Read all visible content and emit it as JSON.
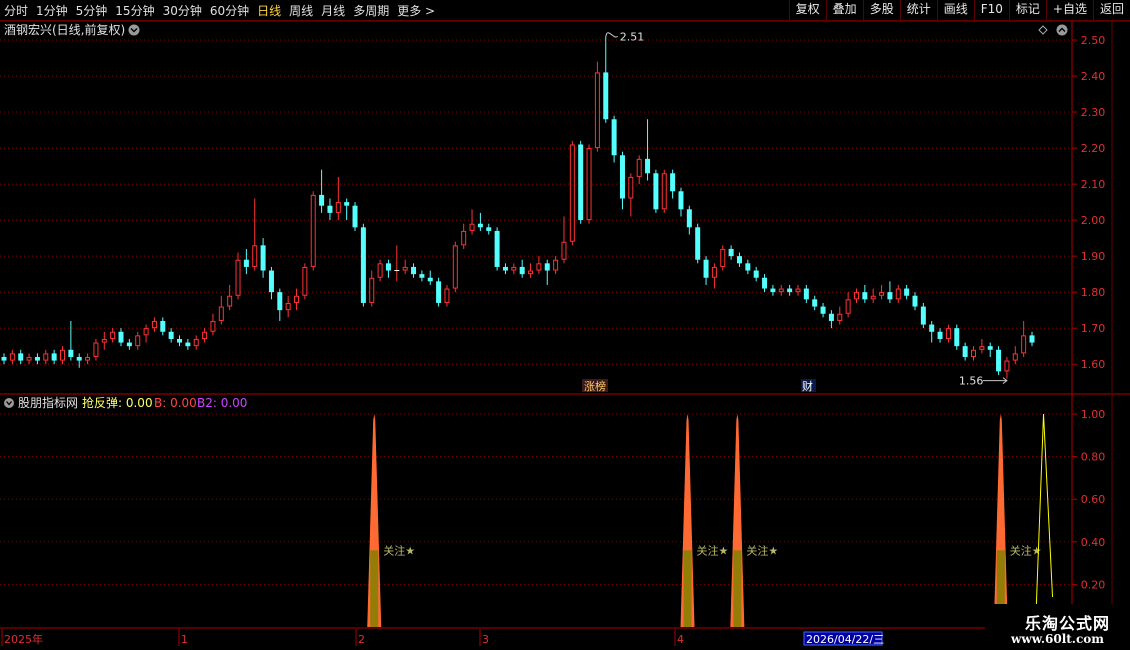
{
  "toolbar": {
    "periods": [
      "分时",
      "1分钟",
      "5分钟",
      "15分钟",
      "30分钟",
      "60分钟",
      "日线",
      "周线",
      "月线",
      "多周期",
      "更多 >"
    ],
    "active_period": "日线",
    "buttons": [
      "复权",
      "叠加",
      "多股",
      "统计",
      "画线",
      "F10",
      "标记",
      "+自选",
      "返回"
    ]
  },
  "main": {
    "title": "酒钢宏兴(日线,前复权)",
    "high_label": "2.51",
    "low_label": "1.56",
    "tag_zhangbang": "涨榜",
    "tag_cai": "财"
  },
  "indicator": {
    "title": "股朋指标网",
    "line1_label": "抢反弹: 0.00",
    "line2_label": "B: 0.00",
    "line3_label": "B2: 0.00",
    "signal_text": "关注★"
  },
  "date_axis": {
    "labels": [
      "2025年",
      "1",
      "2",
      "3",
      "4"
    ],
    "cursor_date": "2026/04/22/三"
  },
  "watermark": {
    "name": "乐淘公式网",
    "url": "www.60lt.com"
  },
  "colors": {
    "up": "#ff3232",
    "down": "#54ffff",
    "signal": "#ff6a33",
    "signal_mid": "#808000",
    "b2": "#ffff00",
    "grid": "#8b0000"
  },
  "chart_data": {
    "type": "candlestick",
    "price_axis": {
      "ylim": [
        1.52,
        2.55
      ],
      "ticks": [
        "2.50",
        "2.40",
        "2.30",
        "2.20",
        "2.10",
        "2.00",
        "1.90",
        "1.80",
        "1.70",
        "1.60"
      ]
    },
    "indicator_axis": {
      "ylim": [
        0,
        1.0
      ],
      "ticks": [
        "1.00",
        "0.80",
        "0.60",
        "0.40",
        "0.20"
      ]
    },
    "candles": [
      [
        1.62,
        1.61,
        1.63,
        1.6
      ],
      [
        1.61,
        1.63,
        1.64,
        1.6
      ],
      [
        1.63,
        1.61,
        1.64,
        1.6
      ],
      [
        1.61,
        1.62,
        1.63,
        1.6
      ],
      [
        1.62,
        1.61,
        1.63,
        1.6
      ],
      [
        1.61,
        1.63,
        1.64,
        1.6
      ],
      [
        1.63,
        1.61,
        1.64,
        1.6
      ],
      [
        1.61,
        1.64,
        1.65,
        1.6
      ],
      [
        1.64,
        1.62,
        1.72,
        1.61
      ],
      [
        1.62,
        1.61,
        1.63,
        1.59
      ],
      [
        1.61,
        1.62,
        1.63,
        1.6
      ],
      [
        1.62,
        1.66,
        1.67,
        1.61
      ],
      [
        1.66,
        1.67,
        1.69,
        1.64
      ],
      [
        1.67,
        1.69,
        1.7,
        1.66
      ],
      [
        1.69,
        1.66,
        1.7,
        1.65
      ],
      [
        1.66,
        1.65,
        1.67,
        1.64
      ],
      [
        1.65,
        1.68,
        1.69,
        1.64
      ],
      [
        1.68,
        1.7,
        1.71,
        1.66
      ],
      [
        1.7,
        1.72,
        1.73,
        1.69
      ],
      [
        1.72,
        1.69,
        1.73,
        1.68
      ],
      [
        1.69,
        1.67,
        1.7,
        1.66
      ],
      [
        1.67,
        1.66,
        1.68,
        1.65
      ],
      [
        1.66,
        1.65,
        1.67,
        1.64
      ],
      [
        1.65,
        1.67,
        1.68,
        1.64
      ],
      [
        1.67,
        1.69,
        1.7,
        1.66
      ],
      [
        1.69,
        1.72,
        1.74,
        1.68
      ],
      [
        1.72,
        1.76,
        1.79,
        1.71
      ],
      [
        1.76,
        1.79,
        1.82,
        1.75
      ],
      [
        1.79,
        1.89,
        1.91,
        1.78
      ],
      [
        1.89,
        1.87,
        1.92,
        1.85
      ],
      [
        1.87,
        1.93,
        2.06,
        1.86
      ],
      [
        1.93,
        1.86,
        1.95,
        1.84
      ],
      [
        1.86,
        1.8,
        1.87,
        1.78
      ],
      [
        1.8,
        1.75,
        1.81,
        1.72
      ],
      [
        1.75,
        1.77,
        1.79,
        1.73
      ],
      [
        1.77,
        1.79,
        1.81,
        1.75
      ],
      [
        1.79,
        1.87,
        1.88,
        1.78
      ],
      [
        1.87,
        2.07,
        2.08,
        1.86
      ],
      [
        2.07,
        2.04,
        2.14,
        2.02
      ],
      [
        2.04,
        2.02,
        2.06,
        2.0
      ],
      [
        2.02,
        2.05,
        2.12,
        2.0
      ],
      [
        2.05,
        2.04,
        2.06,
        2.0
      ],
      [
        2.04,
        1.98,
        2.05,
        1.97
      ],
      [
        1.98,
        1.77,
        1.99,
        1.76
      ],
      [
        1.77,
        1.84,
        1.86,
        1.76
      ],
      [
        1.84,
        1.88,
        1.89,
        1.83
      ],
      [
        1.88,
        1.86,
        1.89,
        1.84
      ],
      [
        1.86,
        1.86,
        1.93,
        1.83
      ],
      [
        1.86,
        1.87,
        1.89,
        1.85
      ],
      [
        1.87,
        1.85,
        1.88,
        1.84
      ],
      [
        1.85,
        1.84,
        1.86,
        1.83
      ],
      [
        1.84,
        1.83,
        1.86,
        1.82
      ],
      [
        1.83,
        1.77,
        1.84,
        1.76
      ],
      [
        1.77,
        1.81,
        1.82,
        1.76
      ],
      [
        1.81,
        1.93,
        1.94,
        1.8
      ],
      [
        1.93,
        1.97,
        1.99,
        1.92
      ],
      [
        1.97,
        1.99,
        2.03,
        1.96
      ],
      [
        1.99,
        1.98,
        2.02,
        1.97
      ],
      [
        1.98,
        1.97,
        1.99,
        1.96
      ],
      [
        1.97,
        1.87,
        1.98,
        1.86
      ],
      [
        1.87,
        1.86,
        1.88,
        1.85
      ],
      [
        1.86,
        1.87,
        1.88,
        1.85
      ],
      [
        1.87,
        1.85,
        1.89,
        1.84
      ],
      [
        1.85,
        1.86,
        1.88,
        1.84
      ],
      [
        1.86,
        1.88,
        1.9,
        1.85
      ],
      [
        1.88,
        1.86,
        1.89,
        1.82
      ],
      [
        1.86,
        1.89,
        1.9,
        1.85
      ],
      [
        1.89,
        1.94,
        2.01,
        1.88
      ],
      [
        1.94,
        2.21,
        2.22,
        1.93
      ],
      [
        2.21,
        2.0,
        2.22,
        1.99
      ],
      [
        2.0,
        2.2,
        2.21,
        1.99
      ],
      [
        2.2,
        2.41,
        2.44,
        2.19
      ],
      [
        2.41,
        2.28,
        2.51,
        2.27
      ],
      [
        2.28,
        2.18,
        2.29,
        2.16
      ],
      [
        2.18,
        2.06,
        2.19,
        2.03
      ],
      [
        2.06,
        2.12,
        2.13,
        2.01
      ],
      [
        2.12,
        2.17,
        2.18,
        2.1
      ],
      [
        2.17,
        2.13,
        2.28,
        2.11
      ],
      [
        2.13,
        2.03,
        2.14,
        2.02
      ],
      [
        2.03,
        2.13,
        2.14,
        2.02
      ],
      [
        2.13,
        2.08,
        2.14,
        2.06
      ],
      [
        2.08,
        2.03,
        2.09,
        2.01
      ],
      [
        2.03,
        1.98,
        2.04,
        1.96
      ],
      [
        1.98,
        1.89,
        1.99,
        1.88
      ],
      [
        1.89,
        1.84,
        1.9,
        1.82
      ],
      [
        1.84,
        1.87,
        1.88,
        1.81
      ],
      [
        1.87,
        1.92,
        1.93,
        1.86
      ],
      [
        1.92,
        1.9,
        1.93,
        1.89
      ],
      [
        1.9,
        1.88,
        1.91,
        1.87
      ],
      [
        1.88,
        1.86,
        1.89,
        1.85
      ],
      [
        1.86,
        1.84,
        1.87,
        1.83
      ],
      [
        1.84,
        1.81,
        1.85,
        1.8
      ],
      [
        1.81,
        1.8,
        1.82,
        1.79
      ],
      [
        1.8,
        1.81,
        1.82,
        1.79
      ],
      [
        1.81,
        1.8,
        1.82,
        1.79
      ],
      [
        1.8,
        1.81,
        1.82,
        1.79
      ],
      [
        1.81,
        1.78,
        1.82,
        1.77
      ],
      [
        1.78,
        1.76,
        1.79,
        1.75
      ],
      [
        1.76,
        1.74,
        1.77,
        1.73
      ],
      [
        1.74,
        1.72,
        1.75,
        1.7
      ],
      [
        1.72,
        1.74,
        1.76,
        1.71
      ],
      [
        1.74,
        1.78,
        1.8,
        1.73
      ],
      [
        1.78,
        1.8,
        1.81,
        1.77
      ],
      [
        1.8,
        1.78,
        1.82,
        1.77
      ],
      [
        1.78,
        1.79,
        1.81,
        1.77
      ],
      [
        1.79,
        1.8,
        1.82,
        1.78
      ],
      [
        1.8,
        1.78,
        1.83,
        1.77
      ],
      [
        1.78,
        1.81,
        1.82,
        1.77
      ],
      [
        1.81,
        1.79,
        1.82,
        1.78
      ],
      [
        1.79,
        1.76,
        1.8,
        1.75
      ],
      [
        1.76,
        1.71,
        1.77,
        1.7
      ],
      [
        1.71,
        1.69,
        1.72,
        1.66
      ],
      [
        1.69,
        1.67,
        1.7,
        1.66
      ],
      [
        1.67,
        1.7,
        1.71,
        1.66
      ],
      [
        1.7,
        1.65,
        1.71,
        1.64
      ],
      [
        1.65,
        1.62,
        1.66,
        1.61
      ],
      [
        1.62,
        1.64,
        1.65,
        1.61
      ],
      [
        1.64,
        1.65,
        1.67,
        1.63
      ],
      [
        1.65,
        1.64,
        1.66,
        1.62
      ],
      [
        1.64,
        1.58,
        1.65,
        1.57
      ],
      [
        1.58,
        1.61,
        1.62,
        1.56
      ],
      [
        1.61,
        1.63,
        1.65,
        1.6
      ],
      [
        1.63,
        1.68,
        1.72,
        1.62
      ],
      [
        1.68,
        1.66,
        1.69,
        1.65
      ]
    ],
    "signal_spikes": [
      {
        "index": 52,
        "value": 1.0,
        "label": "关注★"
      },
      {
        "index": 96,
        "value": 1.0,
        "label": "关注★"
      },
      {
        "index": 103,
        "value": 1.0,
        "label": "关注★"
      },
      {
        "index": 140,
        "value": 1.0,
        "label": "关注★"
      }
    ],
    "b2_spike": {
      "index": 146,
      "value": 1.0
    }
  }
}
